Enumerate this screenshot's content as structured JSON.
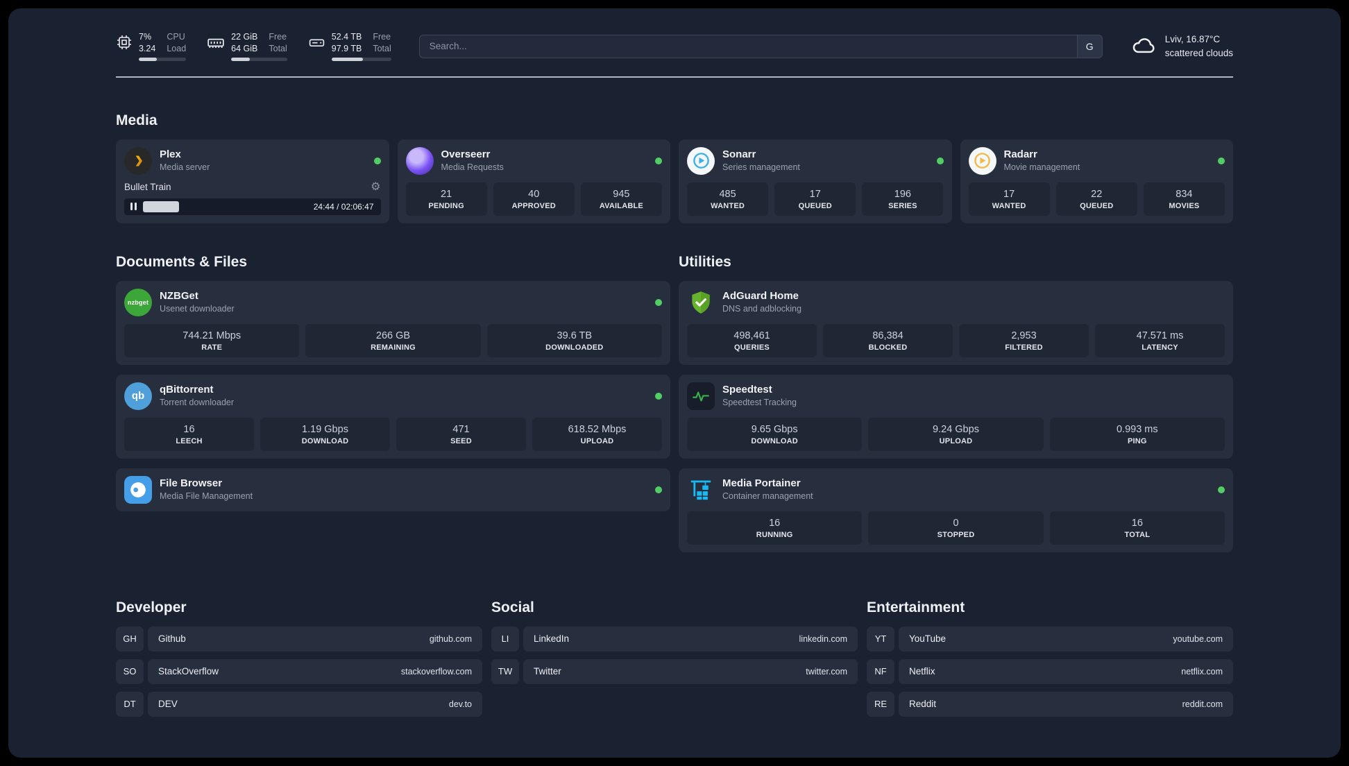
{
  "colors": {
    "status_online": "#51cf66",
    "meter_fill": "#cdd2da",
    "card_bg": "#272e3e",
    "page_bg": "#1a2130"
  },
  "header": {
    "cpu": {
      "value1": "7%",
      "value2": "3.24",
      "label1": "CPU",
      "label2": "Load"
    },
    "ram": {
      "value1": "22 GiB",
      "value2": "64 GiB",
      "label1": "Free",
      "label2": "Total"
    },
    "disk": {
      "value1": "52.4 TB",
      "value2": "97.9 TB",
      "label1": "Free",
      "label2": "Total"
    },
    "search": {
      "placeholder": "Search...",
      "button": "G"
    },
    "weather": {
      "location": "Lviv, 16.87°C",
      "condition": "scattered clouds"
    }
  },
  "media": {
    "title": "Media",
    "plex": {
      "name": "Plex",
      "subtitle": "Media server",
      "now_playing": "Bullet Train",
      "time": "24:44 / 02:06:47"
    },
    "overseerr": {
      "name": "Overseerr",
      "subtitle": "Media Requests",
      "stats": [
        {
          "value": "21",
          "label": "PENDING"
        },
        {
          "value": "40",
          "label": "APPROVED"
        },
        {
          "value": "945",
          "label": "AVAILABLE"
        }
      ]
    },
    "sonarr": {
      "name": "Sonarr",
      "subtitle": "Series management",
      "stats": [
        {
          "value": "485",
          "label": "WANTED"
        },
        {
          "value": "17",
          "label": "QUEUED"
        },
        {
          "value": "196",
          "label": "SERIES"
        }
      ]
    },
    "radarr": {
      "name": "Radarr",
      "subtitle": "Movie management",
      "stats": [
        {
          "value": "17",
          "label": "WANTED"
        },
        {
          "value": "22",
          "label": "QUEUED"
        },
        {
          "value": "834",
          "label": "MOVIES"
        }
      ]
    }
  },
  "files": {
    "title": "Documents & Files",
    "nzbget": {
      "name": "NZBGet",
      "subtitle": "Usenet downloader",
      "icon_text": "nzbget",
      "stats": [
        {
          "value": "744.21 Mbps",
          "label": "RATE"
        },
        {
          "value": "266 GB",
          "label": "REMAINING"
        },
        {
          "value": "39.6 TB",
          "label": "DOWNLOADED"
        }
      ]
    },
    "qbittorrent": {
      "name": "qBittorrent",
      "subtitle": "Torrent downloader",
      "icon_text": "qb",
      "stats": [
        {
          "value": "16",
          "label": "LEECH"
        },
        {
          "value": "1.19 Gbps",
          "label": "DOWNLOAD"
        },
        {
          "value": "471",
          "label": "SEED"
        },
        {
          "value": "618.52 Mbps",
          "label": "UPLOAD"
        }
      ]
    },
    "filebrowser": {
      "name": "File Browser",
      "subtitle": "Media File Management"
    }
  },
  "utilities": {
    "title": "Utilities",
    "adguard": {
      "name": "AdGuard Home",
      "subtitle": "DNS and adblocking",
      "stats": [
        {
          "value": "498,461",
          "label": "QUERIES"
        },
        {
          "value": "86,384",
          "label": "BLOCKED"
        },
        {
          "value": "2,953",
          "label": "FILTERED"
        },
        {
          "value": "47.571 ms",
          "label": "LATENCY"
        }
      ]
    },
    "speedtest": {
      "name": "Speedtest",
      "subtitle": "Speedtest Tracking",
      "stats": [
        {
          "value": "9.65 Gbps",
          "label": "DOWNLOAD"
        },
        {
          "value": "9.24 Gbps",
          "label": "UPLOAD"
        },
        {
          "value": "0.993 ms",
          "label": "PING"
        }
      ]
    },
    "portainer": {
      "name": "Media Portainer",
      "subtitle": "Container management",
      "stats": [
        {
          "value": "16",
          "label": "RUNNING"
        },
        {
          "value": "0",
          "label": "STOPPED"
        },
        {
          "value": "16",
          "label": "TOTAL"
        }
      ]
    }
  },
  "bookmarks": {
    "developer": {
      "title": "Developer",
      "items": [
        {
          "abbr": "GH",
          "name": "Github",
          "url": "github.com"
        },
        {
          "abbr": "SO",
          "name": "StackOverflow",
          "url": "stackoverflow.com"
        },
        {
          "abbr": "DT",
          "name": "DEV",
          "url": "dev.to"
        }
      ]
    },
    "social": {
      "title": "Social",
      "items": [
        {
          "abbr": "LI",
          "name": "LinkedIn",
          "url": "linkedin.com"
        },
        {
          "abbr": "TW",
          "name": "Twitter",
          "url": "twitter.com"
        }
      ]
    },
    "entertainment": {
      "title": "Entertainment",
      "items": [
        {
          "abbr": "YT",
          "name": "YouTube",
          "url": "youtube.com"
        },
        {
          "abbr": "NF",
          "name": "Netflix",
          "url": "netflix.com"
        },
        {
          "abbr": "RE",
          "name": "Reddit",
          "url": "reddit.com"
        }
      ]
    }
  }
}
